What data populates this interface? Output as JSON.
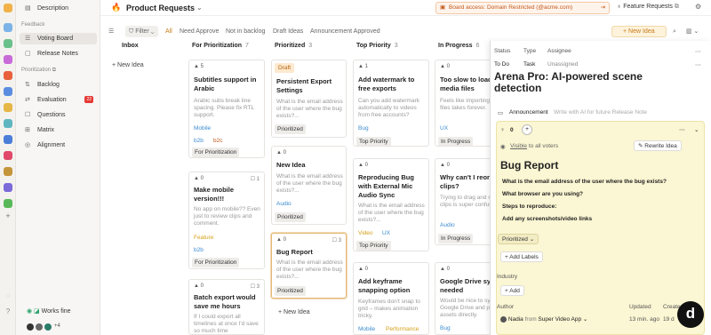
{
  "sidebar": {
    "description": "Description",
    "feedback_header": "Feedback",
    "items": [
      "Voting Board",
      "Release Notes"
    ],
    "prioritization_header": "Prioritization",
    "pitems": [
      "Backlog",
      "Evaluation",
      "Questions",
      "Matrix",
      "Alignment"
    ],
    "evaluation_badge": "22",
    "works_fine": "Works fine",
    "avatar_more": "+4"
  },
  "header": {
    "title": "Product Requests",
    "warning": "Board access: Domain Restricted (@acme.com)",
    "feature_requests": "Feature Requests"
  },
  "filters": {
    "filter": "Filter",
    "tabs": [
      "All",
      "Need Approve",
      "Not in backlog",
      "Draft Ideas",
      "Announcement Approved"
    ],
    "new_idea": "+ New Idea"
  },
  "columns": [
    {
      "name": "Inbox",
      "count": ""
    },
    {
      "name": "For Prioritization",
      "count": "7"
    },
    {
      "name": "Prioritized",
      "count": "3"
    },
    {
      "name": "Top Priority",
      "count": "3"
    },
    {
      "name": "In Progress",
      "count": "6"
    }
  ],
  "inbox_new": "+ New Idea",
  "cards": {
    "c1": {
      "votes": "▲ 5",
      "title": "Subtitles support in Arabic",
      "desc": "Arabic subs break line spacing. Please fix RTL support.",
      "tags": [
        "Mobile",
        "b2b",
        "b2c"
      ],
      "status": "For Prioritization"
    },
    "c2": {
      "votes": "▲ 0",
      "comments": "☐ 1",
      "title": "Make mobile version!!!",
      "desc": "No app on mobile?? Even just to review clips and comment.",
      "tags": [
        "Feature",
        "b2b"
      ],
      "status": "For Prioritization"
    },
    "c3": {
      "votes": "▲ 0",
      "comments": "☐ 3",
      "title": "Batch export would save me hours",
      "desc": "If I could export all timelines at once I'd save so much time"
    },
    "p1": {
      "draft": "Draft",
      "title": "Persistent Export Settings",
      "desc": "What is the email address of the user where the bug exists?...",
      "status": "Prioritized"
    },
    "p2": {
      "votes": "▲ 0",
      "title": "New Idea",
      "desc": "What is the email address of the user where the bug exists?...",
      "tag": "Audio",
      "status": "Prioritized"
    },
    "p3": {
      "votes": "▲ 0",
      "comments": "☐ 3",
      "title": "Bug Report",
      "desc": "What is the email address of the user where the bug exists?...",
      "status": "Prioritized"
    },
    "p_new": "+ New Idea",
    "t1": {
      "votes": "▲ 1",
      "title": "Add watermark to free exports",
      "desc": "Can you add watermark automatically to videos from free accounts?",
      "tag": "Bug",
      "status": "Top Priority"
    },
    "t2": {
      "votes": "▲ 0",
      "title": "Reproducing Bug with External Mic Audio Sync",
      "desc": "What is the email address of the user where the bug exists?...",
      "tags": [
        "Video",
        "UX"
      ],
      "status": "Top Priority"
    },
    "t3": {
      "votes": "▲ 0",
      "title": "Add keyframe snapping option",
      "desc": "Keyframes don't snap to grid – makes animation tricky.",
      "tags": [
        "Mobile",
        "Performance"
      ]
    },
    "i1": {
      "votes": "▲ 0",
      "title": "Too slow to load media files",
      "desc": "Feels like importing large files takes forever.",
      "tag": "UX",
      "status": "In Progress"
    },
    "i2": {
      "votes": "▲ 0",
      "title": "Why can't I reorder clips?",
      "desc": "Trying to drag and reorder clips is super confusing.",
      "tag": "Audio",
      "status": "In Progress"
    },
    "i3": {
      "votes": "▲ 0",
      "title": "Google Drive sync needed",
      "desc": "Would be nice to sync Google Drive and pull assets directly.",
      "tag": "Bug"
    }
  },
  "panel": {
    "status_label": "Status",
    "type_label": "Type",
    "assignee_label": "Assignee",
    "status": "To Do",
    "type": "Task",
    "assignee": "Unassigned",
    "big_title": "Arena Pro: AI-powered scene detection",
    "announcement": "Announcement",
    "announcement_hint": "Write with AI for future Release Note",
    "vote_count": "0",
    "visible": "Visible",
    "visible_rest": "to all voters",
    "rewrite": "Rewrite Idea",
    "bug_title": "Bug Report",
    "q1": "What is the email address of the user where the bug exists?",
    "q2": "What browser are you using?",
    "q3": "Steps to reproduce:",
    "q4": "Add any screenshots/video links",
    "status_select": "Prioritized",
    "add_labels": "+ Add Labels",
    "industry": "Industry",
    "add": "+ Add",
    "author_label": "Author",
    "updated_label": "Updated",
    "created_label": "Created",
    "author_name": "Nadia",
    "author_from": "from",
    "author_org": "Super Video App",
    "updated": "13 min. ago",
    "created": "19 d"
  }
}
